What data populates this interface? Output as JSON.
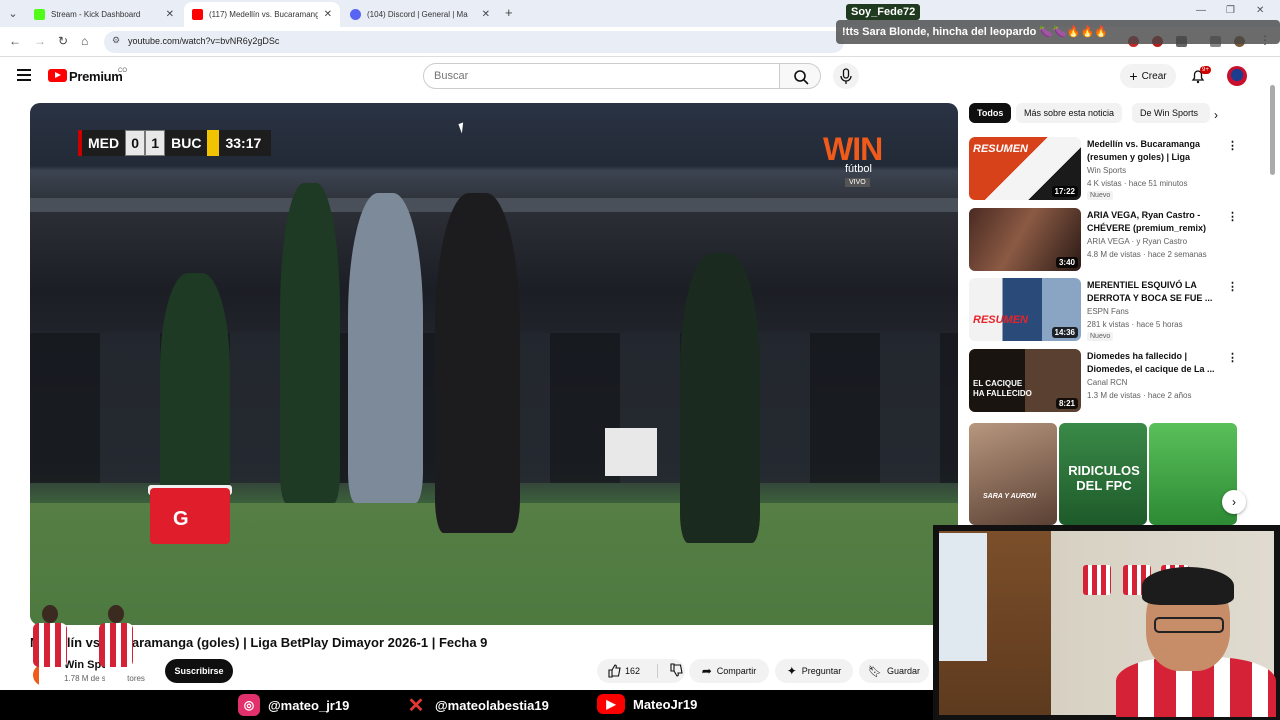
{
  "browser": {
    "tabs": [
      {
        "title": "Stream - Kick Dashboard",
        "favicon_color": "#53fc18"
      },
      {
        "title": "(117) Medellín vs. Bucaramanga",
        "favicon_color": "#ff0000"
      },
      {
        "title": "(104) Discord | General | Ma",
        "favicon_color": "#5865f2"
      }
    ],
    "url": "youtube.com/watch?v=bvNR6y2gDSc"
  },
  "youtube": {
    "brand": "Premium",
    "country_code": "CO",
    "search_placeholder": "Buscar",
    "create_label": "Crear",
    "notification_count": "9+"
  },
  "video": {
    "scoreboard": {
      "home": "MED",
      "home_score": "0",
      "away_score": "1",
      "away": "BUC",
      "clock": "33:17"
    },
    "broadcaster": {
      "name": "WIN",
      "sub": "fútbol",
      "live": "VIVO"
    },
    "title": "Medellín vs. Bucaramanga (goles) | Liga BetPlay Dimayor 2026-1 | Fecha 9",
    "channel": "Win Sports",
    "subscribers": "1.78 M de suscriptores",
    "subscribe_label": "Suscribirse",
    "likes": "162",
    "share_label": "Compartir",
    "ask_label": "Preguntar",
    "save_label": "Guardar"
  },
  "sidebar": {
    "chips": [
      "Todos",
      "Más sobre esta noticia",
      "De Win Sports"
    ],
    "recommendations": [
      {
        "title": "Medellín vs. Bucaramanga (resumen y goles) | Liga BetPl...",
        "channel": "Win Sports",
        "meta": "4 K vistas · hace 51 minutos",
        "duration": "17:22",
        "badge": "Nuevo",
        "thumb_text": "RESUMEN",
        "thumb_color": "#d8421a"
      },
      {
        "title": "ARIA VEGA, Ryan Castro - CHÉVERE (premium_remix) ...",
        "channel": "ARIA VEGA · y Ryan Castro",
        "meta": "4.8 M de vistas · hace 2 semanas",
        "duration": "3:40",
        "badge": "",
        "thumb_text": "",
        "thumb_color": "#6b3a2a"
      },
      {
        "title": "MERENTIEL ESQUIVÓ LA DERROTA Y BOCA SE FUE ...",
        "channel": "ESPN Fans",
        "meta": "281 k vistas · hace 5 horas",
        "duration": "14:36",
        "badge": "Nuevo",
        "thumb_text": "RESUMEN",
        "thumb_color": "#2a4a7a"
      },
      {
        "title": "Diomedes ha fallecido | Diomedes, el cacique de La ...",
        "channel": "Canal RCN",
        "meta": "1.3 M de vistas · hace 2 años",
        "duration": "8:21",
        "badge": "",
        "thumb_text": "EL CACIQUE HA FALLECIDO",
        "thumb_color": "#3a2a1a"
      }
    ],
    "shorts": [
      {
        "text": "SARA Y AURON",
        "color": "#8a6a5a"
      },
      {
        "text": "RIDICULOS DEL FPC",
        "color": "#2f7a3a"
      },
      {
        "text": "",
        "color": "#4aa84a"
      }
    ]
  },
  "stream_overlay": {
    "chat_user": "Soy_Fede72",
    "chat_message": "!tts Sara Blonde, hincha del leopardo 🍆🍆🔥🔥🔥",
    "socials": [
      {
        "handle": "@mateo_jr19",
        "network": "instagram-icon",
        "color": "#e1306c"
      },
      {
        "handle": "@mateolabestia19",
        "network": "x-icon",
        "color": "#000000"
      },
      {
        "handle": "MateoJr19",
        "network": "youtube-icon",
        "color": "#ff0000"
      }
    ]
  }
}
